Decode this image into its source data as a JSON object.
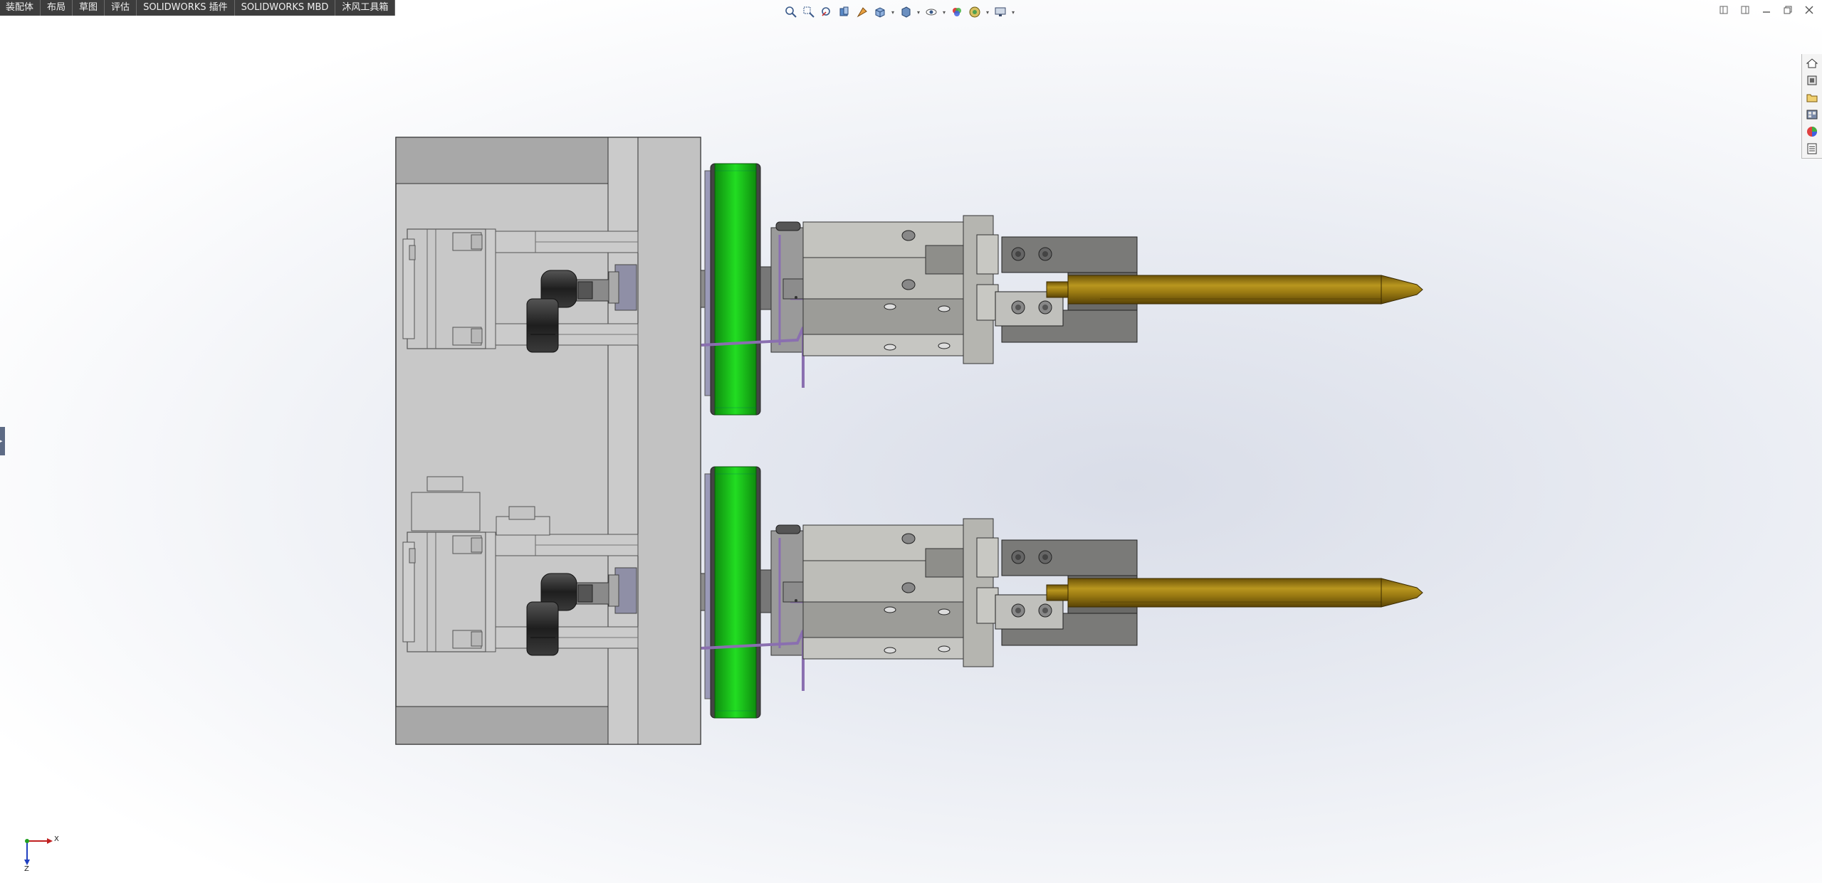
{
  "command_tabs": [
    "装配体",
    "布局",
    "草图",
    "评估",
    "SOLIDWORKS 插件",
    "SOLIDWORKS MBD",
    "沐风工具箱"
  ],
  "view_toolbar": {
    "icons": [
      "zoom-to-fit-icon",
      "zoom-to-area-icon",
      "previous-view-icon",
      "section-view-icon",
      "dynamic-annotation-icon",
      "view-orientation-icon",
      "display-style-icon",
      "hide-show-items-icon",
      "edit-appearance-icon",
      "apply-scene-icon",
      "view-settings-icon"
    ]
  },
  "window_controls": [
    "restore-left-icon",
    "restore-right-icon",
    "minimize-icon",
    "maximize-icon",
    "close-icon"
  ],
  "task_pane": [
    "solidworks-resources-icon",
    "design-library-icon",
    "file-explorer-icon",
    "view-palette-icon",
    "appearances-icon",
    "custom-properties-icon"
  ],
  "triad": {
    "x_label": "X",
    "z_label": "Z"
  },
  "colors": {
    "housing": "#c8c8c8",
    "housing_dark": "#a9a9a9",
    "green_wheel": "#1fd01f",
    "gold_rod": "#9a7a12",
    "dark_block": "#7a7a78",
    "purple_wire": "#8a6fb0",
    "fitting_black": "#2a2a2a",
    "tab_bg": "#3d3d3d"
  }
}
